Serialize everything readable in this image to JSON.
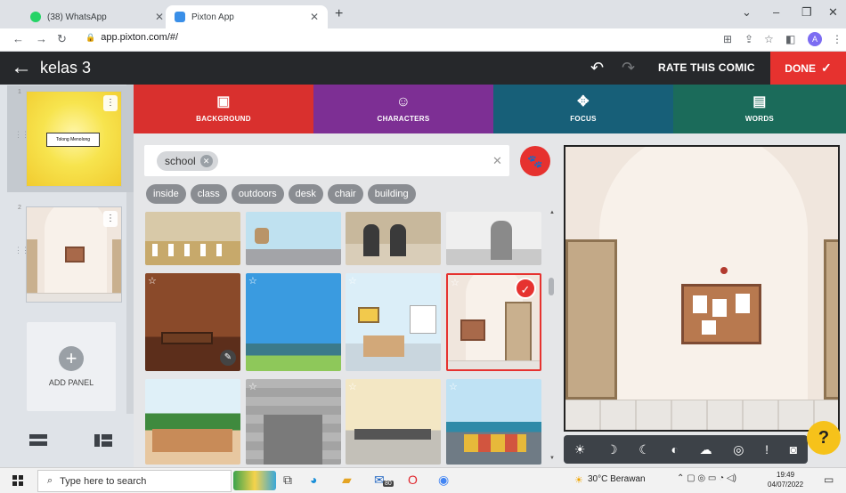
{
  "browser": {
    "tabs": [
      {
        "title": "(38) WhatsApp",
        "active": false,
        "favicon_color": "#25d366"
      },
      {
        "title": "Pixton App",
        "active": true,
        "favicon_color": "#3a8fe8"
      }
    ],
    "new_tab": "+",
    "url": "app.pixton.com/#/",
    "profile_initial": "A"
  },
  "app": {
    "comic_title": "kelas 3",
    "rate_label": "RATE THIS COMIC",
    "done_label": "DONE",
    "accent_red": "#e6322f"
  },
  "panels": [
    {
      "number": "1",
      "caption": "Tolong Menolong"
    },
    {
      "number": "2"
    }
  ],
  "add_panel_label": "ADD PANEL",
  "tabs": [
    {
      "label": "BACKGROUND",
      "color": "#d9302e",
      "icon": "image-icon"
    },
    {
      "label": "CHARACTERS",
      "color": "#7d2f94",
      "icon": "face-icon"
    },
    {
      "label": "FOCUS",
      "color": "#175f78",
      "icon": "move-icon"
    },
    {
      "label": "WORDS",
      "color": "#1b6b5a",
      "icon": "speech-bubble-icon"
    }
  ],
  "search": {
    "chip": "school"
  },
  "tags": [
    "inside",
    "class",
    "outdoors",
    "desk",
    "chair",
    "building"
  ],
  "taskbar": {
    "search_placeholder": "Type here to search",
    "weather": "30°C Berawan",
    "time": "19:49",
    "date": "04/07/2022",
    "mail_badge": "80"
  }
}
